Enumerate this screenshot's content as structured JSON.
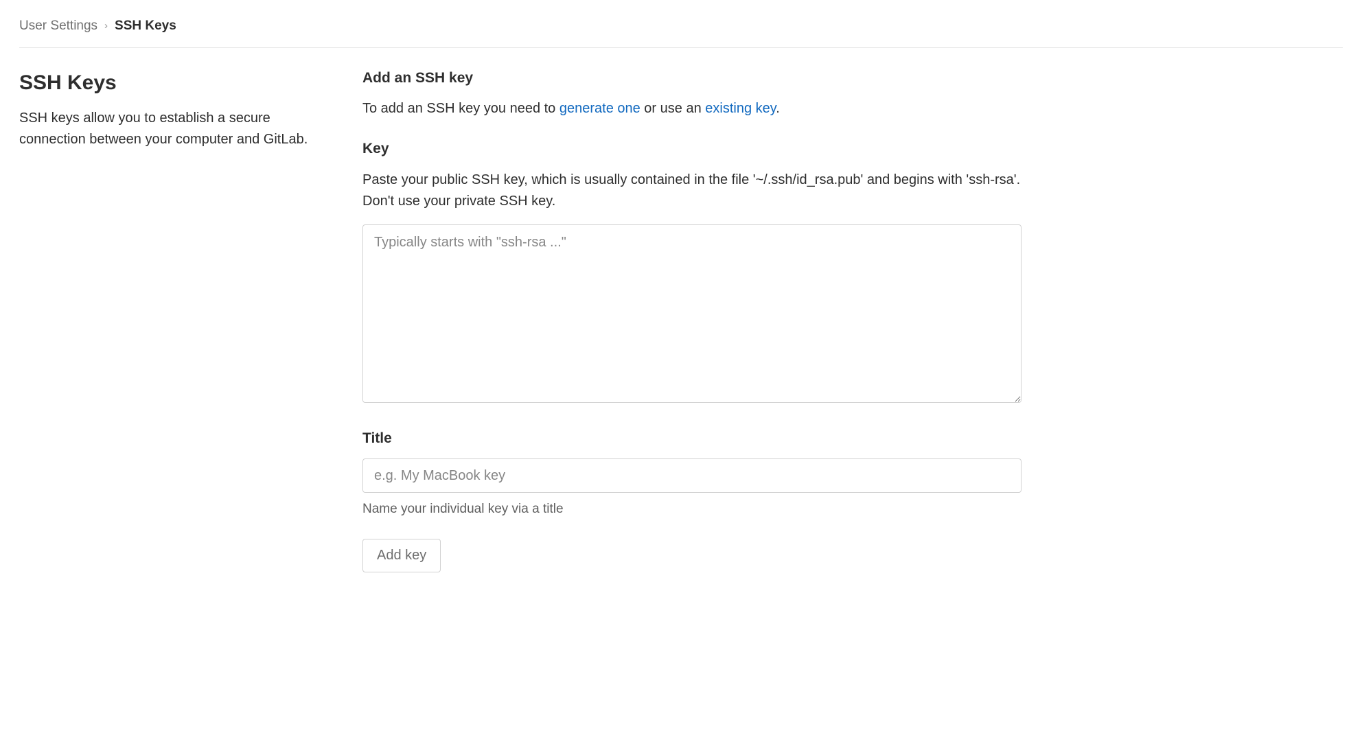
{
  "breadcrumb": {
    "parent": "User Settings",
    "current": "SSH Keys"
  },
  "sidebar": {
    "title": "SSH Keys",
    "description": "SSH keys allow you to establish a secure connection between your computer and GitLab."
  },
  "main": {
    "add_heading": "Add an SSH key",
    "add_intro_prefix": "To add an SSH key you need to ",
    "add_intro_link1": "generate one",
    "add_intro_middle": " or use an ",
    "add_intro_link2": "existing key",
    "add_intro_suffix": ".",
    "key_label": "Key",
    "key_help": "Paste your public SSH key, which is usually contained in the file '~/.ssh/id_rsa.pub' and begins with 'ssh-rsa'. Don't use your private SSH key.",
    "key_placeholder": "Typically starts with \"ssh-rsa ...\"",
    "key_value": "",
    "title_label": "Title",
    "title_placeholder": "e.g. My MacBook key",
    "title_value": "",
    "title_help": "Name your individual key via a title",
    "submit_label": "Add key"
  }
}
